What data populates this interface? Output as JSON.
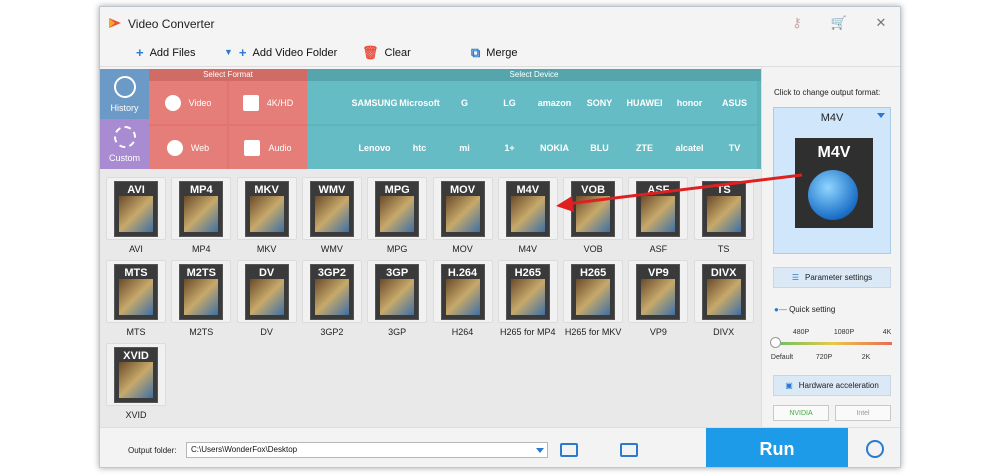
{
  "app": {
    "title": "Video Converter"
  },
  "toolbar": {
    "add_files": "Add Files",
    "add_video_folder": "Add Video Folder",
    "clear": "Clear",
    "merge": "Merge"
  },
  "sidebar": {
    "history": "History",
    "custom": "Custom"
  },
  "ribbon": {
    "select_format": "Select Format",
    "select_device": "Select Device",
    "formats": [
      "Video",
      "4K/HD",
      "Web",
      "Audio"
    ],
    "devices_row1": [
      "",
      "SAMSUNG",
      "Microsoft",
      "G",
      "LG",
      "amazon",
      "SONY",
      "HUAWEI",
      "honor",
      "ASUS"
    ],
    "devices_row2": [
      "",
      "Lenovo",
      "htc",
      "mi",
      "1+",
      "NOKIA",
      "BLU",
      "ZTE",
      "alcatel",
      "TV"
    ]
  },
  "grid": {
    "tiles": [
      {
        "box": "AVI",
        "label": "AVI"
      },
      {
        "box": "MP4",
        "label": "MP4"
      },
      {
        "box": "MKV",
        "label": "MKV"
      },
      {
        "box": "WMV",
        "label": "WMV"
      },
      {
        "box": "MPG",
        "label": "MPG"
      },
      {
        "box": "MOV",
        "label": "MOV"
      },
      {
        "box": "M4V",
        "label": "M4V"
      },
      {
        "box": "VOB",
        "label": "VOB"
      },
      {
        "box": "ASF",
        "label": "ASF"
      },
      {
        "box": "TS",
        "label": "TS"
      },
      {
        "box": "MTS",
        "label": "MTS"
      },
      {
        "box": "M2TS",
        "label": "M2TS"
      },
      {
        "box": "DV",
        "label": "DV"
      },
      {
        "box": "3GP2",
        "label": "3GP2"
      },
      {
        "box": "3GP",
        "label": "3GP"
      },
      {
        "box": "H.264",
        "label": "H264"
      },
      {
        "box": "H265",
        "label": "H265 for MP4"
      },
      {
        "box": "H265",
        "label": "H265 for MKV"
      },
      {
        "box": "VP9",
        "label": "VP9"
      },
      {
        "box": "DIVX",
        "label": "DIVX"
      },
      {
        "box": "XVID",
        "label": "XVID"
      }
    ]
  },
  "right_panel": {
    "caption": "Click to change output format:",
    "selected_format": "M4V",
    "card_label": "M4V",
    "parameter_settings": "Parameter settings",
    "quick_setting": "Quick setting",
    "top_ticks": [
      "480P",
      "1080P",
      "4K"
    ],
    "bottom_ticks": [
      "Default",
      "720P",
      "2K"
    ],
    "hardware_acceleration": "Hardware acceleration",
    "nvidia": "NVIDIA",
    "intel": "Intel",
    "quality_level": 0
  },
  "bottom": {
    "output_folder_label": "Output folder:",
    "output_path": "C:\\Users\\WonderFox\\Desktop",
    "run": "Run"
  },
  "colors": {
    "format_panel": "#e2756f",
    "device_panel": "#5fb3bb",
    "history": "#6c9ac6",
    "custom": "#a98bd1",
    "run": "#1e9be8",
    "arrow": "#e02020"
  }
}
